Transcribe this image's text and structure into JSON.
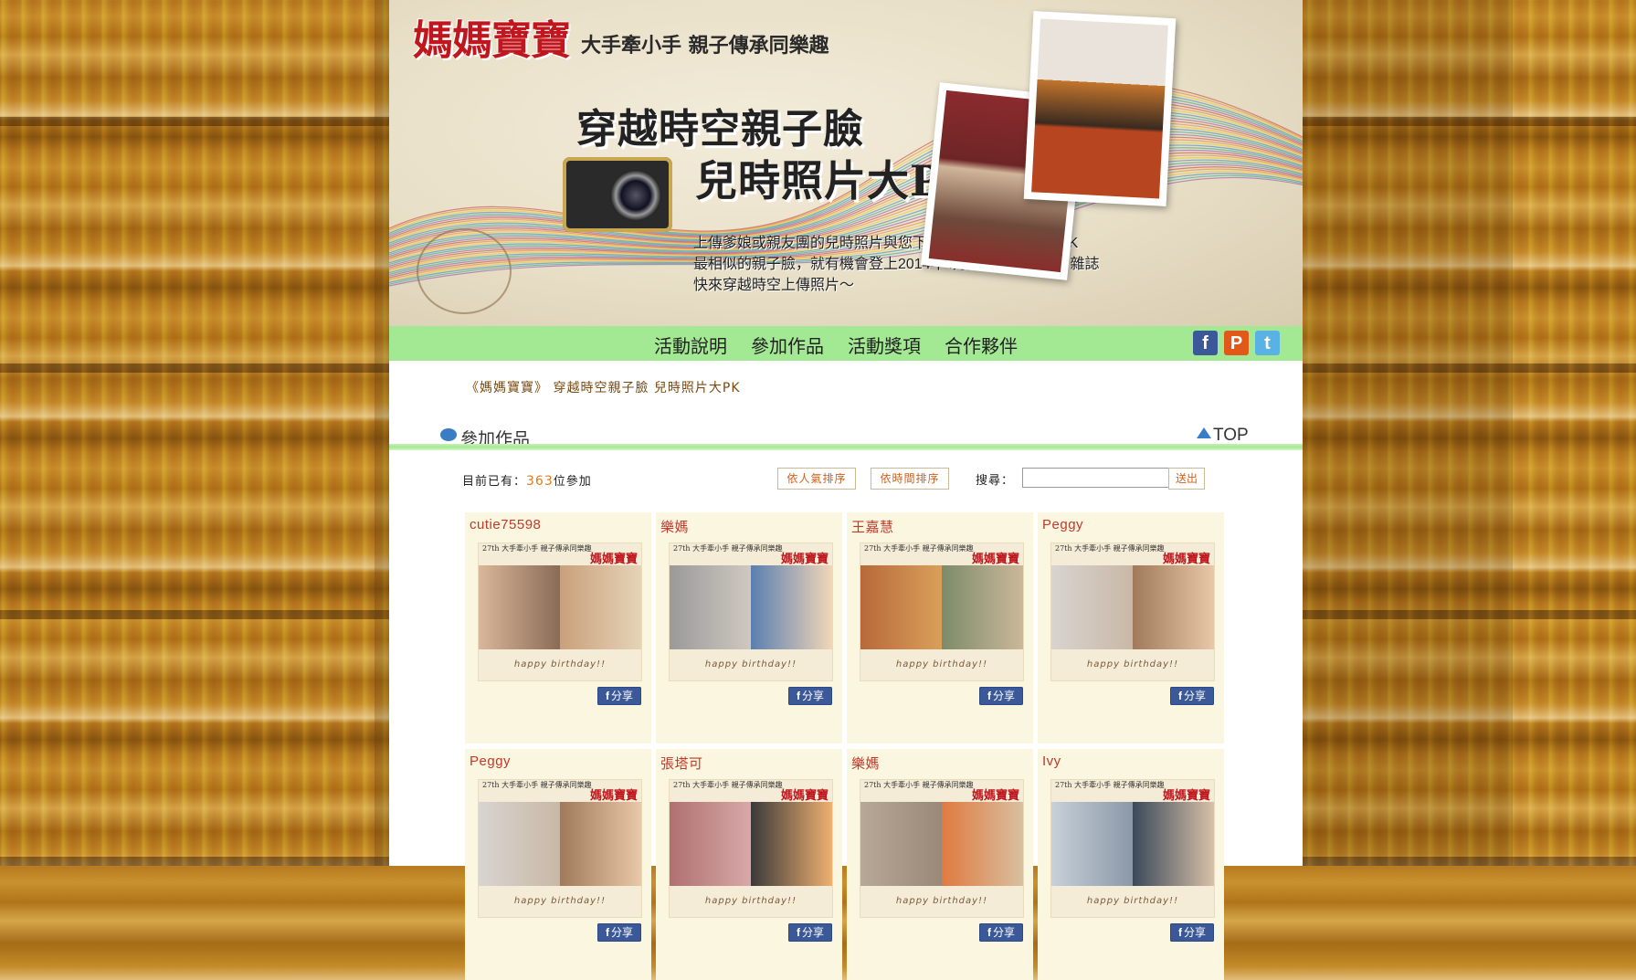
{
  "banner": {
    "logo": "媽媽寶寶",
    "slogan": "大手牽小手 親子傳承同樂趣",
    "title_line1": "穿越時空親子臉",
    "title_line2": "兒時照片大PK",
    "desc_line1": "上傳爹娘或親友團的兒時照片與您下一代寶寶照片進行大PK",
    "desc_line2": "最相似的親子臉，就有機會登上2014年4月號《媽媽寶寶》雜誌",
    "desc_line3": "快來穿越時空上傳照片～"
  },
  "nav": {
    "items": [
      "活動說明",
      "參加作品",
      "活動獎項",
      "合作夥伴"
    ],
    "social": [
      "f",
      "P",
      "t"
    ]
  },
  "breadcrumb": "《媽媽寶寶》 穿越時空親子臉 兒時照片大PK",
  "section": {
    "title": "參加作品",
    "top_label": "TOP"
  },
  "toolbar": {
    "count_prefix": "目前已有：",
    "count": "363",
    "count_suffix": "位參加",
    "sort_popular": "依人氣排序",
    "sort_time": "依時間排序",
    "search_label": "搜尋：",
    "search_value": "",
    "submit": "送出"
  },
  "card_common": {
    "img_top": "27th 大手牽小手 親子傳承同樂趣",
    "img_brand": "媽媽寶寶",
    "img_bottom": "happy birthday!!",
    "share_f": "f",
    "share_label": "分享"
  },
  "cards": [
    {
      "name": "cutie75598"
    },
    {
      "name": "樂媽"
    },
    {
      "name": "王嘉慧"
    },
    {
      "name": "Peggy"
    },
    {
      "name": "Peggy"
    },
    {
      "name": "張塔可"
    },
    {
      "name": "樂媽"
    },
    {
      "name": "Ivy"
    }
  ],
  "colors": {
    "nav_bg": "#a3e993",
    "card_bg": "#fbf6df",
    "name_color": "#c0392b",
    "brand_red": "#c0161e",
    "count_accent": "#e07a1c"
  }
}
